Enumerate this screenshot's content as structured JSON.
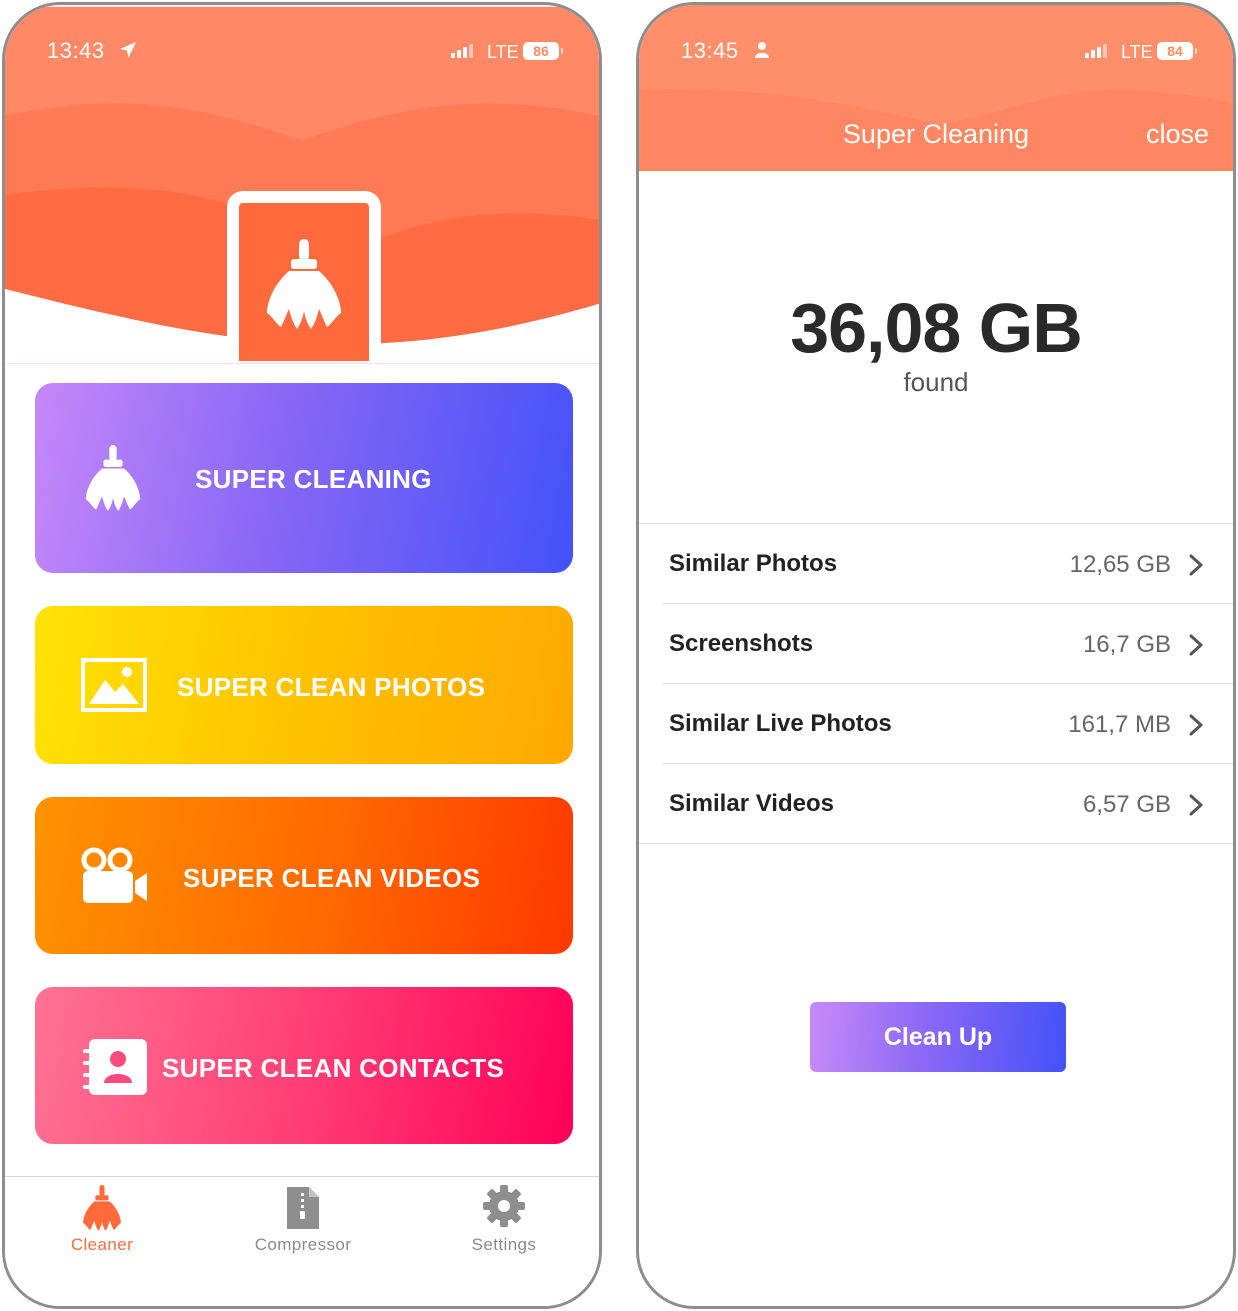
{
  "left": {
    "status": {
      "time": "13:43",
      "network": "LTE",
      "battery": "86"
    },
    "cards": [
      {
        "label": "SUPER CLEANING",
        "icon": "broom-icon",
        "color": "#7a6cf7"
      },
      {
        "label": "SUPER CLEAN PHOTOS",
        "icon": "photo-icon",
        "color": "#ffc200"
      },
      {
        "label": "SUPER CLEAN VIDEOS",
        "icon": "video-camera-icon",
        "color": "#ff6800"
      },
      {
        "label": "SUPER CLEAN CONTACTS",
        "icon": "contact-book-icon",
        "color": "#ff3e76"
      }
    ],
    "tabs": [
      {
        "label": "Cleaner",
        "icon": "broom-icon",
        "active": true
      },
      {
        "label": "Compressor",
        "icon": "zip-file-icon",
        "active": false
      },
      {
        "label": "Settings",
        "icon": "gear-icon",
        "active": false
      }
    ]
  },
  "right": {
    "status": {
      "time": "13:45",
      "network": "LTE",
      "battery": "84"
    },
    "nav": {
      "title": "Super Cleaning",
      "close": "close"
    },
    "summary": {
      "total": "36,08 GB",
      "found": "found"
    },
    "items": [
      {
        "name": "Similar Photos",
        "size": "12,65 GB"
      },
      {
        "name": "Screenshots",
        "size": "16,7 GB"
      },
      {
        "name": "Similar Live Photos",
        "size": "161,7 MB"
      },
      {
        "name": "Similar Videos",
        "size": "6,57 GB"
      }
    ],
    "cleanup_label": "Clean Up"
  },
  "colors": {
    "accent": "#ff6a3d",
    "header": "#ff8e6b",
    "button_start": "#c88af8",
    "button_end": "#4352f8"
  }
}
